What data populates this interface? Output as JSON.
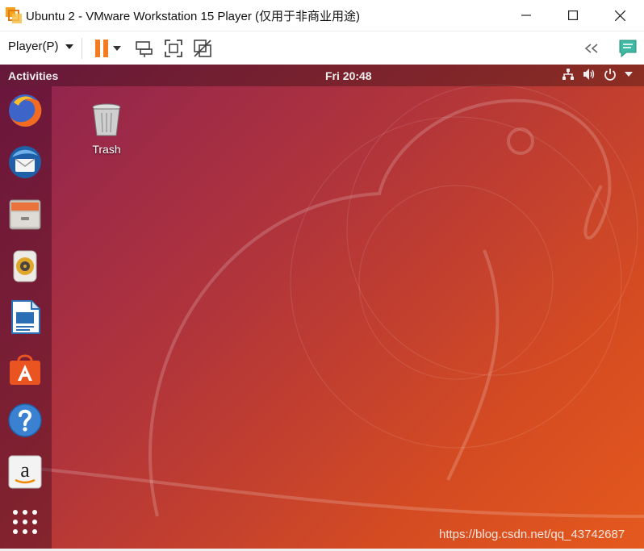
{
  "window": {
    "title": "Ubuntu 2 - VMware Workstation 15 Player (仅用于非商业用途)",
    "minimize": "minimize",
    "maximize": "maximize",
    "close": "close"
  },
  "toolbar": {
    "player_menu_label": "Player(P)",
    "icons": [
      "pause-icon",
      "chevron-down-icon",
      "send-ctrl-alt-del-icon",
      "fullscreen-icon",
      "unity-icon",
      "collapse-icon",
      "message-icon"
    ]
  },
  "ubuntu": {
    "activities": "Activities",
    "clock": "Fri 20:48",
    "tray_icons": [
      "network-icon",
      "volume-icon",
      "power-icon",
      "chevron-down-icon"
    ],
    "desktop_icons": [
      {
        "label": "Trash",
        "icon": "trash-icon"
      }
    ],
    "dock_apps": [
      {
        "name": "Firefox",
        "icon": "firefox-icon"
      },
      {
        "name": "Thunderbird",
        "icon": "thunderbird-icon"
      },
      {
        "name": "Files",
        "icon": "files-icon"
      },
      {
        "name": "Rhythmbox",
        "icon": "rhythmbox-icon"
      },
      {
        "name": "LibreOffice Writer",
        "icon": "writer-icon"
      },
      {
        "name": "Ubuntu Software",
        "icon": "software-icon"
      },
      {
        "name": "Help",
        "icon": "help-icon"
      },
      {
        "name": "Amazon",
        "icon": "amazon-icon"
      },
      {
        "name": "Show Applications",
        "icon": "app-grid-icon"
      }
    ]
  },
  "watermark": "https://blog.csdn.net/qq_43742687",
  "colors": {
    "ubuntu_orange": "#e95420",
    "aubergine": "#77216f",
    "vmware_orange": "#f47b20"
  }
}
